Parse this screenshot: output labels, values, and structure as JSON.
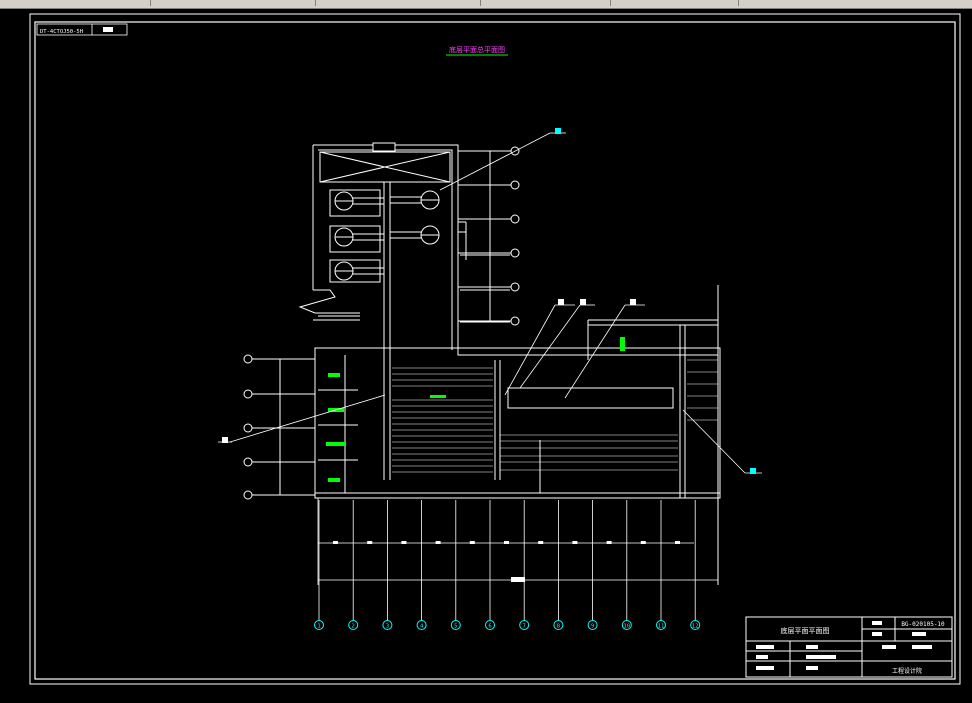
{
  "drawing_code": "DT-4CTOJ50-5H",
  "title": "底层平面总平面图",
  "titleblock": {
    "drawing_title": "底层平面平面图",
    "drawing_number": "BG-020105-10",
    "company": "工程设计院"
  },
  "grid_axes": [
    "1",
    "2",
    "3",
    "4",
    "5",
    "6",
    "7",
    "8",
    "9",
    "10",
    "11",
    "12"
  ],
  "colors": {
    "line": "#ffffff",
    "cyan": "#00ffff",
    "green": "#00ff00",
    "magenta": "#ff40ff",
    "background": "#000000"
  }
}
